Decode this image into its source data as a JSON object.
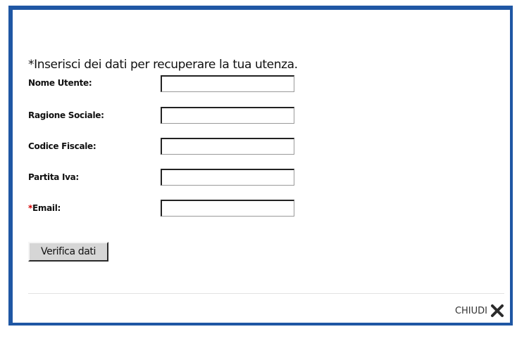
{
  "form": {
    "intro": "*Inserisci dei dati per recuperare la tua utenza.",
    "fields": [
      {
        "label": "Nome Utente:",
        "value": ""
      },
      {
        "label": "Ragione Sociale:",
        "value": ""
      },
      {
        "label": "Codice Fiscale:",
        "value": ""
      },
      {
        "label": "Partita Iva:",
        "value": ""
      },
      {
        "required_mark": "*",
        "label": "Email:",
        "value": ""
      }
    ],
    "submit_label": "Verifica dati"
  },
  "footer": {
    "close_label": "CHIUDI",
    "close_icon": "close-icon"
  },
  "colors": {
    "border": "#1f57a4",
    "required": "#d40000"
  }
}
